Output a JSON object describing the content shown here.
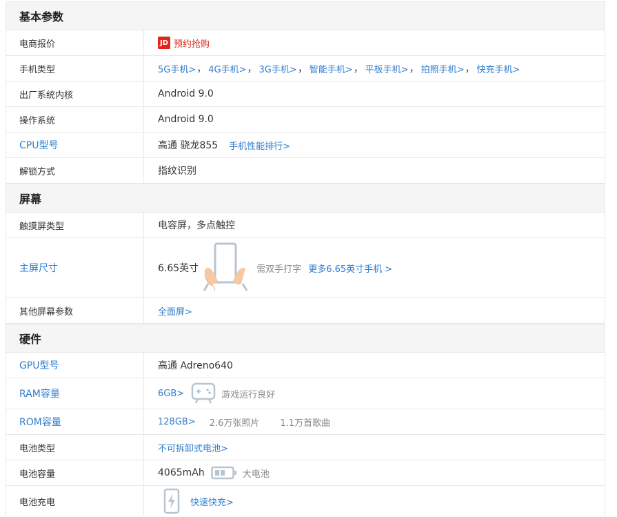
{
  "sections": {
    "basic": {
      "title": "基本参数",
      "price": {
        "label": "电商报价",
        "jd_badge": "JD",
        "link": "预约抢购"
      },
      "phone_type": {
        "label": "手机类型",
        "links": [
          "5G手机>",
          "4G手机>",
          "3G手机>",
          "智能手机>",
          "平板手机>",
          "拍照手机>",
          "快充手机>"
        ],
        "separator": "，"
      },
      "factory_os": {
        "label": "出厂系统内核",
        "value": "Android 9.0"
      },
      "os": {
        "label": "操作系统",
        "value": "Android 9.0"
      },
      "cpu": {
        "label": "CPU型号",
        "value": "高通 骁龙855",
        "link": "手机性能排行>"
      },
      "unlock": {
        "label": "解锁方式",
        "value": "指纹识别"
      }
    },
    "screen": {
      "title": "屏幕",
      "touch": {
        "label": "触摸屏类型",
        "value": "电容屏，多点触控"
      },
      "size": {
        "label": "主屏尺寸",
        "value": "6.65英寸",
        "hint": "需双手打字",
        "link": "更多6.65英寸手机 >"
      },
      "other": {
        "label": "其他屏幕参数",
        "link": "全面屏>"
      }
    },
    "hardware": {
      "title": "硬件",
      "gpu": {
        "label": "GPU型号",
        "value": "高通 Adreno640"
      },
      "ram": {
        "label": "RAM容量",
        "link": "6GB>",
        "hint": "游戏运行良好"
      },
      "rom": {
        "label": "ROM容量",
        "link": "128GB>",
        "photos": "2.6万张照片",
        "songs": "1.1万首歌曲"
      },
      "battery_type": {
        "label": "电池类型",
        "link": "不可拆卸式电池>"
      },
      "battery_cap": {
        "label": "电池容量",
        "value": "4065mAh",
        "hint": "大电池"
      },
      "charge": {
        "label": "电池充电",
        "link": "快速快充>"
      }
    }
  },
  "colors": {
    "link": "#2f7ccf",
    "jd_red": "#e1251b",
    "icon_gray": "#b8c4d0"
  },
  "icons": [
    "jd-logo",
    "two-hands-phone-icon",
    "gamepad-icon",
    "battery-icon",
    "flash-charge-icon"
  ]
}
